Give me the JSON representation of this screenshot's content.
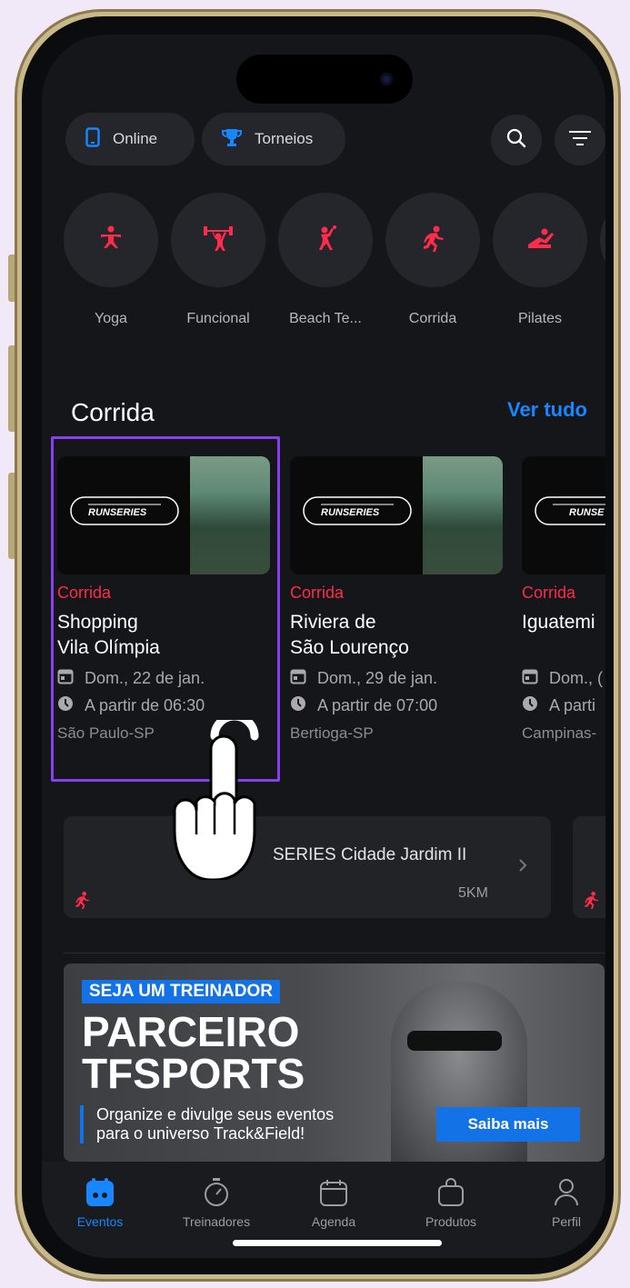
{
  "filters": {
    "online_label": "Online",
    "tournaments_label": "Torneios"
  },
  "categories": [
    {
      "label": "Yoga",
      "icon": "yoga-icon"
    },
    {
      "label": "Funcional",
      "icon": "weightlifting-icon"
    },
    {
      "label": "Beach Te...",
      "icon": "beach-tennis-icon"
    },
    {
      "label": "Corrida",
      "icon": "running-icon"
    },
    {
      "label": "Pilates",
      "icon": "pilates-icon"
    }
  ],
  "section": {
    "title": "Corrida",
    "see_all": "Ver tudo"
  },
  "events": [
    {
      "category": "Corrida",
      "name_line1": "Shopping",
      "name_line2": "Vila Olímpia",
      "date": "Dom., 22 de jan.",
      "time": "A partir de 06:30",
      "city": "São Paulo-SP",
      "logo_text": "RUNSERIES"
    },
    {
      "category": "Corrida",
      "name_line1": "Riviera de",
      "name_line2": "São Lourenço",
      "date": "Dom., 29 de jan.",
      "time": "A partir de 07:00",
      "city": "Bertioga-SP",
      "logo_text": "RUNSERIES"
    },
    {
      "category": "Corrida",
      "name_line1": "Iguatemi",
      "name_line2": "",
      "date": "Dom., (",
      "time": "A parti",
      "city": "Campinas-",
      "logo_text": "RUNSE"
    }
  ],
  "list_item": {
    "title": "SERIES Cidade Jardim II",
    "distance": "5KM"
  },
  "banner": {
    "tag": "SEJA UM TREINADOR",
    "title_line1": "PARCEIRO",
    "title_line2": "TFSPORTS",
    "subtitle_line1": "Organize e divulge seus eventos",
    "subtitle_line2": "para o universo Track&Field!",
    "button": "Saiba mais"
  },
  "tabs": [
    {
      "label": "Eventos",
      "active": true
    },
    {
      "label": "Treinadores",
      "active": false
    },
    {
      "label": "Agenda",
      "active": false
    },
    {
      "label": "Produtos",
      "active": false
    },
    {
      "label": "Perfil",
      "active": false
    }
  ],
  "colors": {
    "accent": "#1786ff",
    "category_red": "#ff2b4a",
    "highlight": "#8b3df0",
    "background": "#15161a"
  }
}
